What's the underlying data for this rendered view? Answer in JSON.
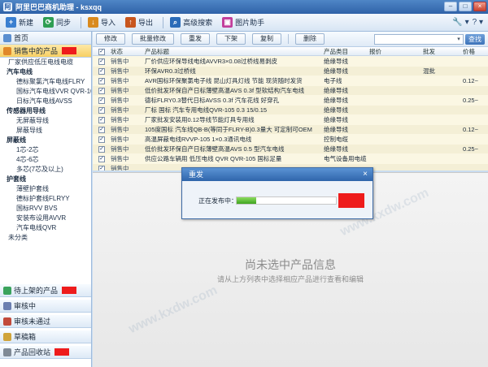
{
  "app": {
    "title": "阿里巴巴商机助理 - ksxqq",
    "logo_char": "阿"
  },
  "window_controls": {
    "minimize": "–",
    "maximize": "□",
    "close": "×"
  },
  "toolbar": {
    "new_label": "新建",
    "sync_label": "同步",
    "import_label": "导入",
    "export_label": "导出",
    "advanced_search_label": "高级搜索",
    "image_helper_label": "图片助手",
    "tools_glyph": "🔧 ▾",
    "help_glyph": "? ▾"
  },
  "sidebar": {
    "home": "首页",
    "on_sale": "销售中的产品",
    "pending": "待上架的产品",
    "reviewing": "审核中",
    "rejected": "审核未通过",
    "drafts": "草稿箱",
    "recycle": "产品回收站",
    "tree": [
      {
        "label": "厂家供应低压电线电缆",
        "kind": "l1"
      },
      {
        "label": "汽车电线",
        "kind": "group"
      },
      {
        "label": "德标聚氯汽车电线FLRY",
        "kind": "sub"
      },
      {
        "label": "国标汽车电线VVR QVR-105",
        "kind": "sub"
      },
      {
        "label": "日标汽车电线AVSS",
        "kind": "sub"
      },
      {
        "label": "传感器用导线",
        "kind": "group"
      },
      {
        "label": "无屏蔽导线",
        "kind": "sub"
      },
      {
        "label": "屏蔽导线",
        "kind": "sub"
      },
      {
        "label": "屏蔽线",
        "kind": "group"
      },
      {
        "label": "1芯-2芯",
        "kind": "sub"
      },
      {
        "label": "4芯-6芯",
        "kind": "sub"
      },
      {
        "label": "多芯(7芯及以上)",
        "kind": "sub"
      },
      {
        "label": "护套线",
        "kind": "group"
      },
      {
        "label": "薄壁护套线",
        "kind": "sub"
      },
      {
        "label": "德标护套线FLRYY",
        "kind": "sub"
      },
      {
        "label": "国标RVV BVS",
        "kind": "sub"
      },
      {
        "label": "安装布设用AVVR",
        "kind": "sub"
      },
      {
        "label": "汽车电线QVR",
        "kind": "sub"
      },
      {
        "label": "未分类",
        "kind": "l1"
      }
    ]
  },
  "actions": {
    "edit": "修改",
    "batch_edit": "批量修改",
    "republish": "重发",
    "delist": "下架",
    "copy": "复制",
    "delete": "删除",
    "search_placeholder": "",
    "search_button": "查找"
  },
  "table": {
    "columns": [
      "状态",
      "产品标题",
      "产品类目",
      "报价",
      "批发",
      "价格"
    ],
    "rows": [
      {
        "status": "销售中",
        "title": "厂价供应环保导线电线AVVR3×0.08过桥线易剥皮",
        "category": "绝缘导线",
        "wholesale": "",
        "price": ""
      },
      {
        "status": "销售中",
        "title": "环保AVR0.3过桥线",
        "category": "绝缘导线",
        "wholesale": "混批",
        "price": ""
      },
      {
        "status": "销售中",
        "title": "AVR国标环保聚氯电子线 昆山灯具灯线 节能 现货随时发货",
        "category": "电子线",
        "wholesale": "",
        "price": "0.12~"
      },
      {
        "status": "销售中",
        "title": "低价批发环保自产日标薄壁高温AVS 0.3f 型软结构汽车电线",
        "category": "绝缘导线",
        "wholesale": "",
        "price": ""
      },
      {
        "status": "销售中",
        "title": "德标FLRY0.3替代日标AVSS 0.3f 汽车花线 好穿孔",
        "category": "绝缘导线",
        "wholesale": "",
        "price": "0.25~"
      },
      {
        "status": "销售中",
        "title": "厂标 国标 汽车专用电线QVR-105 0.3 15/0.15",
        "category": "绝缘导线",
        "wholesale": "",
        "price": ""
      },
      {
        "status": "销售中",
        "title": "厂家批发安装用0.12导线节能灯具专用线",
        "category": "绝缘导线",
        "wholesale": "",
        "price": ""
      },
      {
        "status": "销售中",
        "title": "105度国标 汽车线QB-B(等同于FLRY-B)0.3量大 可定制可OEM",
        "category": "绝缘导线",
        "wholesale": "",
        "price": "0.12~"
      },
      {
        "status": "销售中",
        "title": "高温屏蔽电线RVVP-105 1×0.3通讯电线",
        "category": "控制电缆",
        "wholesale": "",
        "price": ""
      },
      {
        "status": "销售中",
        "title": "低价批发环保自产日标薄壁高温AVS 0.5 型汽车电线",
        "category": "绝缘导线",
        "wholesale": "",
        "price": "0.25~"
      },
      {
        "status": "销售中",
        "title": "供应公路车辆用 低压电线 QVR QVR-105 国标足量",
        "category": "电气设备用电缆",
        "wholesale": "",
        "price": ""
      },
      {
        "status": "销售中",
        "title": "",
        "category": "",
        "wholesale": "",
        "price": ""
      }
    ]
  },
  "detail": {
    "empty_title": "尚未选中产品信息",
    "empty_hint": "请从上方列表中选择相应产品进行查看和编辑",
    "watermark": "www.kxdw.com"
  },
  "dialog": {
    "title": "重发",
    "close_glyph": "×",
    "progress_label": "正在发布中：",
    "progress_fraction": 0.2
  }
}
